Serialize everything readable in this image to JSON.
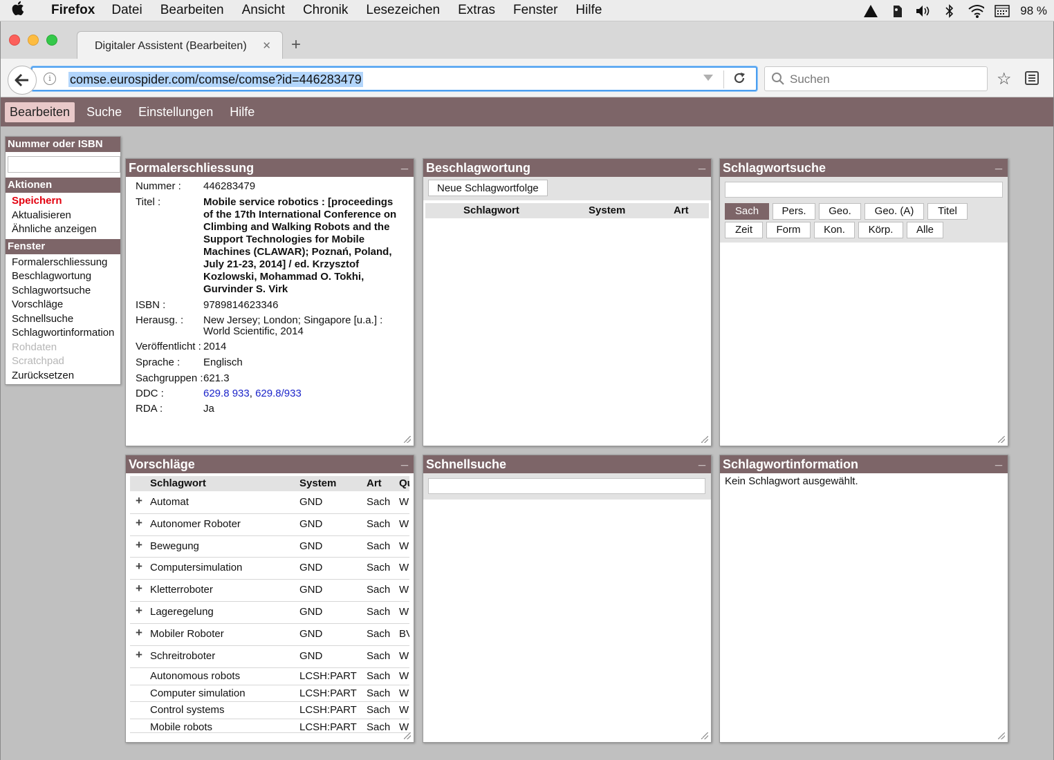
{
  "menubar": {
    "app_name": "Firefox",
    "items": [
      "Datei",
      "Bearbeiten",
      "Ansicht",
      "Chronik",
      "Lesezeichen",
      "Extras",
      "Fenster",
      "Hilfe"
    ],
    "battery": "98 %"
  },
  "browser": {
    "tab_title": "Digitaler Assistent (Bearbeiten)",
    "url": "comse.eurospider.com/comse/comse?id=446283479",
    "search_placeholder": "Suchen"
  },
  "app_menu": {
    "items": [
      "Bearbeiten",
      "Suche",
      "Einstellungen",
      "Hilfe"
    ],
    "active": "Bearbeiten"
  },
  "side": {
    "number_header": "Nummer oder ISBN",
    "actions_header": "Aktionen",
    "actions": [
      "Speichern",
      "Aktualisieren",
      "Ähnliche anzeigen"
    ],
    "window_header": "Fenster",
    "windows": [
      "Formalerschliessung",
      "Beschlagwortung",
      "Schlagwortsuche",
      "Vorschläge",
      "Schnellsuche",
      "Schlagwortinformation",
      "Rohdaten",
      "Scratchpad",
      "Zurücksetzen"
    ]
  },
  "formal": {
    "title": "Formalerschliessung",
    "min": "_",
    "nummer_label": "Nummer :",
    "nummer": "446283479",
    "titel_label": "Titel :",
    "titel": "Mobile service robotics : [proceedings of the 17th International Conference on Climbing and Walking Robots and the Support Technologies for Mobile Machines (CLAWAR); Poznań, Poland, July 21-23, 2014] / ed. Krzysztof Kozlowski, Mohammad O. Tokhi, Gurvinder S. Virk",
    "isbn_label": "ISBN :",
    "isbn": "9789814623346",
    "herausg_label": "Herausg. :",
    "herausg": "New Jersey; London; Singapore [u.a.] : World Scientific, 2014",
    "veroeff_label": "Veröffentlicht :",
    "veroeff": "2014",
    "sprache_label": "Sprache :",
    "sprache": "Englisch",
    "sachgruppen_label": "Sachgruppen :",
    "sachgruppen": "621.3",
    "ddc_label": "DDC :",
    "ddc1": "629.8 933",
    "ddc_sep": ",",
    "ddc2": "629.8/933",
    "rda_label": "RDA :",
    "rda": "Ja"
  },
  "beschlag": {
    "title": "Beschlagwortung",
    "min": "_",
    "button": "Neue Schlagwortfolge",
    "col_schlagwort": "Schlagwort",
    "col_system": "System",
    "col_art": "Art"
  },
  "swsuche": {
    "title": "Schlagwortsuche",
    "min": "_",
    "tabs_row1": [
      "Sach",
      "Pers.",
      "Geo.",
      "Geo. (A)",
      "Titel"
    ],
    "tabs_row2": [
      "Zeit",
      "Form",
      "Kon.",
      "Körp.",
      "Alle"
    ],
    "active": "Sach"
  },
  "vorschlaege": {
    "title": "Vorschläge",
    "min": "_",
    "col_schlagwort": "Schlagwort",
    "col_system": "System",
    "col_art": "Art",
    "col_q": "Qu",
    "rows": [
      {
        "plus": "+",
        "name": "Automat",
        "system": "GND",
        "art": "Sach",
        "q": "W"
      },
      {
        "plus": "+",
        "name": "Autonomer Roboter",
        "system": "GND",
        "art": "Sach",
        "q": "W"
      },
      {
        "plus": "+",
        "name": "Bewegung",
        "system": "GND",
        "art": "Sach",
        "q": "W"
      },
      {
        "plus": "+",
        "name": "Computersimulation",
        "system": "GND",
        "art": "Sach",
        "q": "W"
      },
      {
        "plus": "+",
        "name": "Kletterroboter",
        "system": "GND",
        "art": "Sach",
        "q": "W"
      },
      {
        "plus": "+",
        "name": "Lageregelung",
        "system": "GND",
        "art": "Sach",
        "q": "W"
      },
      {
        "plus": "+",
        "name": "Mobiler Roboter",
        "system": "GND",
        "art": "Sach",
        "q": "BV"
      },
      {
        "plus": "+",
        "name": "Schreitroboter",
        "system": "GND",
        "art": "Sach",
        "q": "W"
      },
      {
        "plus": "",
        "name": "Autonomous robots",
        "system": "LCSH:PART",
        "art": "Sach",
        "q": "W"
      },
      {
        "plus": "",
        "name": "Computer simulation",
        "system": "LCSH:PART",
        "art": "Sach",
        "q": "W"
      },
      {
        "plus": "",
        "name": "Control systems",
        "system": "LCSH:PART",
        "art": "Sach",
        "q": "W"
      },
      {
        "plus": "",
        "name": "Mobile robots",
        "system": "LCSH:PART",
        "art": "Sach",
        "q": "W"
      }
    ]
  },
  "schnell": {
    "title": "Schnellsuche",
    "min": "_"
  },
  "swinfo": {
    "title": "Schlagwortinformation",
    "min": "_",
    "text": "Kein Schlagwort ausgewählt."
  }
}
